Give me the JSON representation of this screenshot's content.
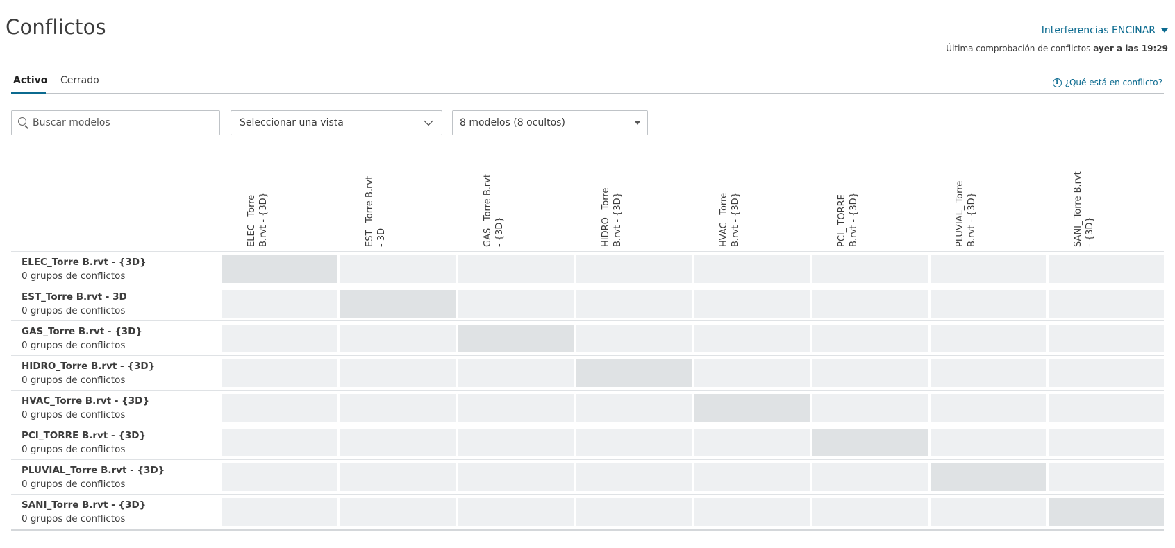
{
  "page": {
    "title": "Conflictos"
  },
  "test_selector": {
    "label": "Interferencias ENCINAR"
  },
  "last_check": {
    "prefix": "Última comprobación de conflictos",
    "value": "ayer a las 19:29"
  },
  "tabs": [
    {
      "label": "Activo",
      "active": true
    },
    {
      "label": "Cerrado",
      "active": false
    }
  ],
  "help": {
    "label": "¿Qué está en conflicto?"
  },
  "search": {
    "placeholder": "Buscar modelos",
    "value": ""
  },
  "view_select": {
    "value": "Seleccionar una vista"
  },
  "models_select": {
    "value": "8 modelos (8 ocultos)"
  },
  "matrix": {
    "columns": [
      "ELEC_ Torre B.rvt - {3D}",
      "EST_ Torre B.rvt - 3D",
      "GAS_ Torre B.rvt - {3D}",
      "HIDRO_ Torre B.rvt - {3D}",
      "HVAC_ Torre B.rvt - {3D}",
      "PCI_ TORRE B.rvt - {3D}",
      "PLUVIAL_ Torre B.rvt - {3D}",
      "SANI_ Torre B.rvt - {3D}"
    ],
    "rows": [
      {
        "name": "ELEC_Torre B.rvt - {3D}",
        "count": "0 grupos de conflictos"
      },
      {
        "name": "EST_Torre B.rvt - 3D",
        "count": "0 grupos de conflictos"
      },
      {
        "name": "GAS_Torre B.rvt - {3D}",
        "count": "0 grupos de conflictos"
      },
      {
        "name": "HIDRO_Torre B.rvt - {3D}",
        "count": "0 grupos de conflictos"
      },
      {
        "name": "HVAC_Torre B.rvt - {3D}",
        "count": "0 grupos de conflictos"
      },
      {
        "name": "PCI_TORRE B.rvt - {3D}",
        "count": "0 grupos de conflictos"
      },
      {
        "name": "PLUVIAL_Torre B.rvt - {3D}",
        "count": "0 grupos de conflictos"
      },
      {
        "name": "SANI_Torre B.rvt - {3D}",
        "count": "0 grupos de conflictos"
      }
    ]
  },
  "colors": {
    "accent": "#0b6a8f",
    "cell": "#eef0f2",
    "cell_diagonal": "#dfe2e4"
  },
  "icons": {
    "search": "search-icon",
    "info": "info-icon",
    "chevron": "chevron-down-icon"
  }
}
